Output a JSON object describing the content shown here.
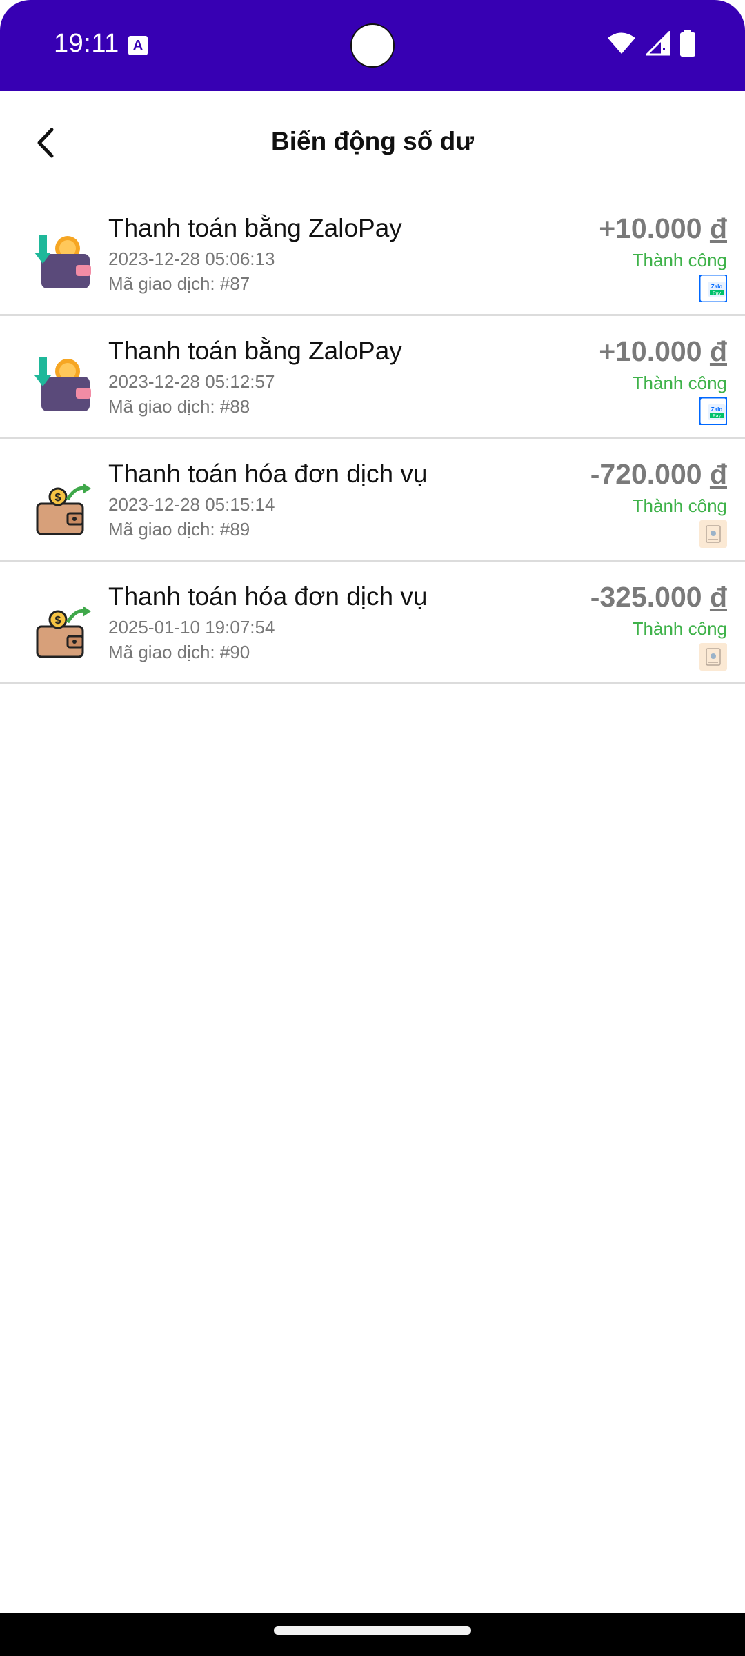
{
  "status_bar": {
    "time": "19:11",
    "notification_icon": "A"
  },
  "app_bar": {
    "title": "Biến động số dư",
    "back_icon": "chevron-left-icon"
  },
  "transactions": [
    {
      "title": "Thanh toán bằng ZaloPay",
      "datetime": "2023-12-28 05:06:13",
      "code": "Mã giao dịch: #87",
      "amount": "+10.000",
      "currency": "đ",
      "status": "Thành công",
      "icon": "wallet-deposit-icon",
      "method": "zalopay-icon"
    },
    {
      "title": "Thanh toán bằng ZaloPay",
      "datetime": "2023-12-28 05:12:57",
      "code": "Mã giao dịch: #88",
      "amount": "+10.000",
      "currency": "đ",
      "status": "Thành công",
      "icon": "wallet-deposit-icon",
      "method": "zalopay-icon"
    },
    {
      "title": "Thanh toán hóa đơn dịch vụ",
      "datetime": "2023-12-28 05:15:14",
      "code": "Mã giao dịch: #89",
      "amount": "-720.000",
      "currency": "đ",
      "status": "Thành công",
      "icon": "wallet-payment-icon",
      "method": "service-bill-icon"
    },
    {
      "title": "Thanh toán hóa đơn dịch vụ",
      "datetime": "2025-01-10 19:07:54",
      "code": "Mã giao dịch: #90",
      "amount": "-325.000",
      "currency": "đ",
      "status": "Thành công",
      "icon": "wallet-payment-icon",
      "method": "service-bill-icon"
    }
  ],
  "colors": {
    "status_bar": "#3700b3",
    "success": "#3fb24a",
    "amount": "#7a7a7a"
  }
}
